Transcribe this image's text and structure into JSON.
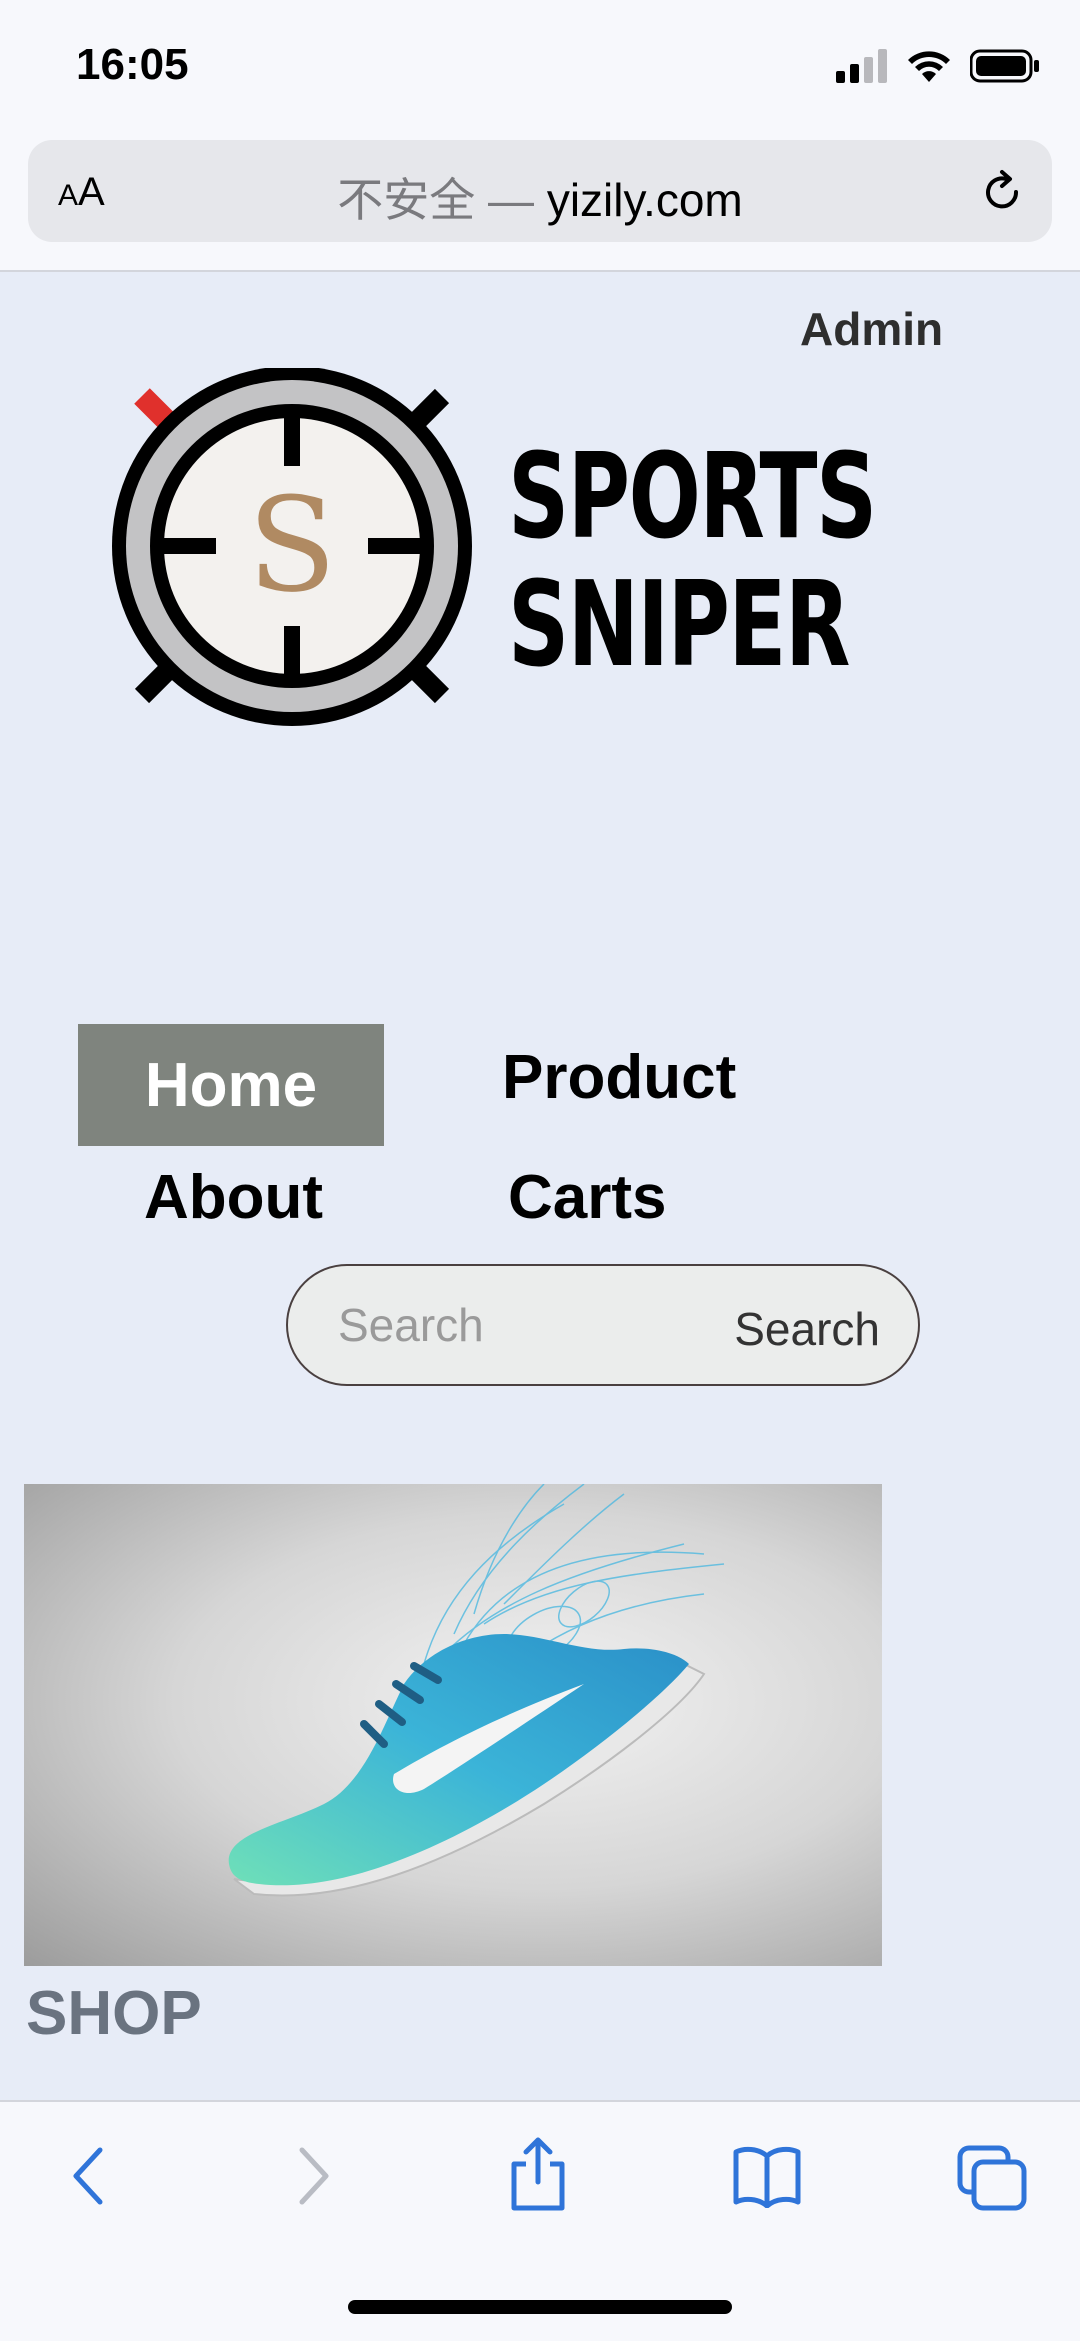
{
  "status": {
    "time": "16:05"
  },
  "browser": {
    "aa_label_small": "A",
    "aa_label_large": "A",
    "insecure_label": "不安全",
    "separator": "—",
    "domain": "yizily.com"
  },
  "header": {
    "admin_link": "Admin",
    "brand_line1": "SPORTS",
    "brand_line2": "SNIPER",
    "logo_letter": "S"
  },
  "nav": {
    "home": "Home",
    "product": "Product",
    "about": "About",
    "carts": "Carts"
  },
  "search": {
    "placeholder": "Search",
    "button": "Search"
  },
  "main": {
    "section_title": "SHOP"
  },
  "colors": {
    "page_bg": "#e7ecf7",
    "nav_active_bg": "#7f847e",
    "logo_accent": "#e0302c",
    "logo_letter": "#b08a62",
    "link_blue": "#2f74d9"
  }
}
